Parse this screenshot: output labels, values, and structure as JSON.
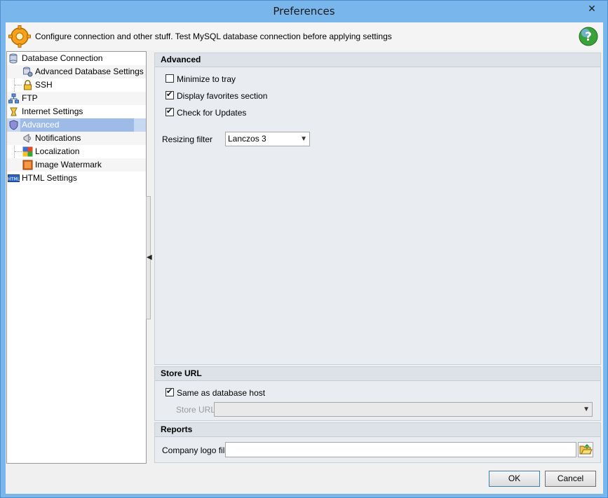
{
  "window": {
    "title": "Preferences",
    "close_glyph": "✕"
  },
  "header": {
    "text": "Configure connection and other stuff. Test MySQL database connection before applying settings"
  },
  "tree": [
    {
      "label": "Database Connection",
      "icon": "database-icon",
      "level": 0
    },
    {
      "label": "Advanced Database Settings",
      "icon": "database-settings-icon",
      "level": 1
    },
    {
      "label": "SSH",
      "icon": "lock-icon",
      "level": 1
    },
    {
      "label": "FTP",
      "icon": "network-icon",
      "level": 0
    },
    {
      "label": "Internet Settings",
      "icon": "internet-icon",
      "level": 0
    },
    {
      "label": "Advanced",
      "icon": "shield-icon",
      "level": 0,
      "selected": true
    },
    {
      "label": "Notifications",
      "icon": "megaphone-icon",
      "level": 1
    },
    {
      "label": "Localization",
      "icon": "flags-icon",
      "level": 1
    },
    {
      "label": "Image Watermark",
      "icon": "image-icon",
      "level": 1
    },
    {
      "label": "HTML Settings",
      "icon": "html-icon",
      "level": 0
    }
  ],
  "advanced": {
    "title": "Advanced",
    "minimize_to_tray": {
      "label": "Minimize to tray",
      "checked": false
    },
    "display_favorites": {
      "label": "Display favorites section",
      "checked": true
    },
    "check_updates": {
      "label": "Check for Updates",
      "checked": true
    },
    "resizing_filter": {
      "label": "Resizing filter",
      "value": "Lanczos 3"
    }
  },
  "store_url": {
    "title": "Store URL",
    "same_as_host": {
      "label": "Same as database host",
      "checked": true
    },
    "url_label": "Store URL",
    "url_value": ""
  },
  "reports": {
    "title": "Reports",
    "logo_label": "Company logo file",
    "logo_value": ""
  },
  "buttons": {
    "ok": "OK",
    "cancel": "Cancel"
  },
  "colors": {
    "title_bar": "#79b6ec",
    "selection": "#9dbbe6",
    "panel_bg": "#e9edf2"
  }
}
